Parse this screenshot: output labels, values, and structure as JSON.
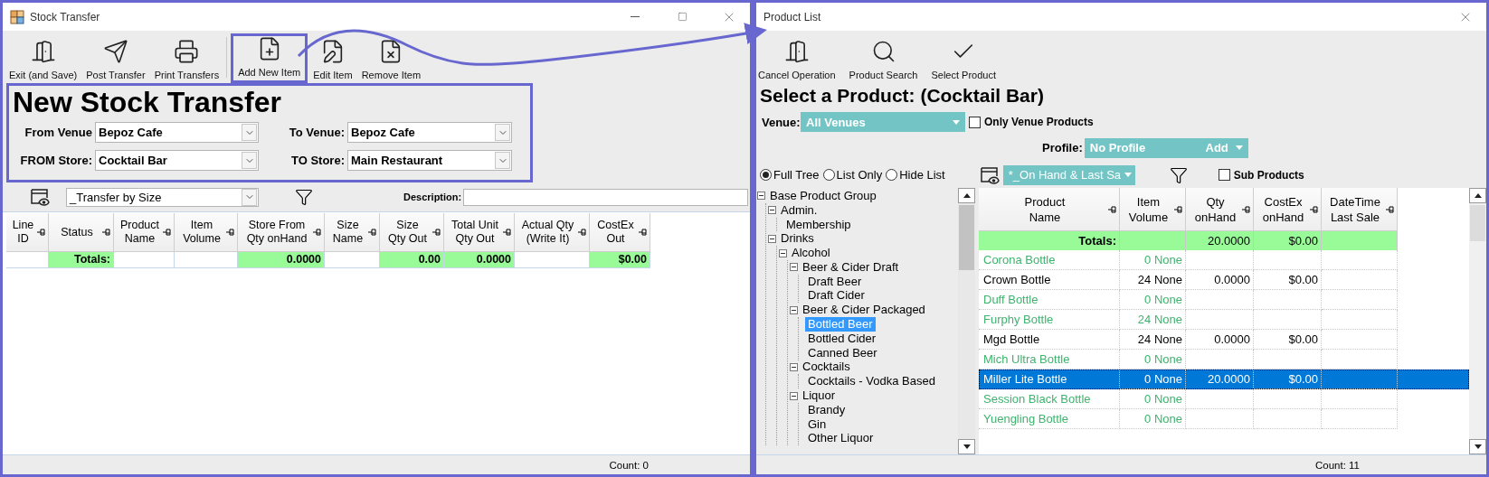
{
  "stock_transfer": {
    "title": "Stock Transfer",
    "toolbar": [
      {
        "label": "Exit (and Save)",
        "kind": "exit",
        "separator_before": false,
        "highlighted": false
      },
      {
        "label": "Post Transfer",
        "kind": "send",
        "separator_before": false,
        "highlighted": false
      },
      {
        "label": "Print Transfers",
        "kind": "print",
        "separator_before": false,
        "highlighted": false
      },
      {
        "label": "Add New Item",
        "kind": "add",
        "separator_before": true,
        "highlighted": true
      },
      {
        "label": "Edit Item",
        "kind": "edit",
        "separator_before": false,
        "highlighted": false
      },
      {
        "label": "Remove Item",
        "kind": "remove",
        "separator_before": false,
        "highlighted": false
      }
    ],
    "form_highlighted": true,
    "heading": "New Stock Transfer",
    "fields": [
      {
        "label": "From Venue",
        "value": "Bepoz Cafe"
      },
      {
        "label": "To Venue:",
        "value": "Bepoz Cafe"
      },
      {
        "label": "FROM Store:",
        "value": "Cocktail Bar"
      },
      {
        "label": "TO Store:",
        "value": "Main Restaurant"
      }
    ],
    "layout": "_Transfer by Size",
    "description_label": "Description:",
    "columns": [
      "Line\nID",
      "Status",
      "Product\nName",
      "Item\nVolume",
      "Store From\nQty onHand",
      "Size\nName",
      "Size\nQty Out",
      "Total Unit\nQty Out",
      "Actual Qty\n(Write It)",
      "CostEx\nOut"
    ],
    "totals": [
      {
        "highlighted": false
      },
      {
        "value": "Totals:",
        "highlighted": true
      },
      {
        "highlighted": false
      },
      {
        "highlighted": false
      },
      {
        "value": "0.0000",
        "highlighted": true
      },
      {
        "highlighted": false
      },
      {
        "value": "0.00",
        "highlighted": true
      },
      {
        "value": "0.0000",
        "highlighted": true
      },
      {
        "highlighted": false
      },
      {
        "value": "$0.00",
        "highlighted": true
      }
    ],
    "count": "Count: 0"
  },
  "product_list": {
    "title": "Product List",
    "toolbar": [
      {
        "label": "Cancel Operation",
        "kind": "exit"
      },
      {
        "label": "Product Search",
        "kind": "search"
      },
      {
        "label": "Select Product",
        "kind": "check"
      }
    ],
    "heading": "Select a Product: (Cocktail Bar)",
    "venue_label": "Venue:",
    "venue": "All Venues",
    "only_venue_products": {
      "label": "Only Venue Products",
      "checked": false
    },
    "profile_label": "Profile:",
    "profile": "No Profile",
    "profile_add": "Add",
    "view_options": [
      {
        "label": "Full Tree",
        "selected": true
      },
      {
        "label": "List Only",
        "selected": false
      },
      {
        "label": "Hide List",
        "selected": false
      }
    ],
    "layout": "*_On Hand & Last Sa",
    "sub_products": {
      "label": "Sub Products",
      "checked": false
    },
    "tree": [
      {
        "label": "Base Product Group",
        "expanded": true,
        "selected": false,
        "children": [
          {
            "label": "Admin.",
            "expanded": true,
            "selected": false,
            "children": [
              {
                "label": "Membership",
                "selected": false
              }
            ]
          },
          {
            "label": "Drinks",
            "expanded": true,
            "selected": false,
            "children": [
              {
                "label": "Alcohol",
                "expanded": true,
                "selected": false,
                "children": [
                  {
                    "label": "Beer & Cider Draft",
                    "expanded": true,
                    "selected": false,
                    "children": [
                      {
                        "label": "Draft Beer",
                        "selected": false
                      },
                      {
                        "label": "Draft Cider",
                        "selected": false
                      }
                    ]
                  },
                  {
                    "label": "Beer & Cider Packaged",
                    "expanded": true,
                    "selected": false,
                    "children": [
                      {
                        "label": "Bottled Beer",
                        "selected": true
                      },
                      {
                        "label": "Bottled Cider",
                        "selected": false
                      },
                      {
                        "label": "Canned Beer",
                        "selected": false
                      }
                    ]
                  },
                  {
                    "label": "Cocktails",
                    "expanded": true,
                    "selected": false,
                    "children": [
                      {
                        "label": "Cocktails - Vodka Based",
                        "selected": false
                      }
                    ]
                  },
                  {
                    "label": "Liquor",
                    "expanded": true,
                    "selected": false,
                    "children": [
                      {
                        "label": "Brandy",
                        "selected": false
                      },
                      {
                        "label": "Gin",
                        "selected": false
                      },
                      {
                        "label": "Other Liquor",
                        "selected": false
                      }
                    ]
                  }
                ]
              }
            ]
          }
        ]
      }
    ],
    "columns": [
      "Product\nName",
      "Item\nVolume",
      "Qty\nonHand",
      "CostEx\nonHand",
      "DateTime\nLast Sale"
    ],
    "totals": [
      {
        "value": "Totals:",
        "highlighted": true
      },
      {
        "highlighted": true
      },
      {
        "value": "20.0000",
        "highlighted": true
      },
      {
        "value": "$0.00",
        "highlighted": true
      },
      {
        "highlighted": true
      }
    ],
    "rows": [
      {
        "name": "Corona Bottle",
        "volume": "0 None",
        "in_stock": false,
        "selected": false
      },
      {
        "name": "Crown Bottle",
        "volume": "24 None",
        "qty": "0.0000",
        "cost": "$0.00",
        "in_stock": true,
        "selected": false
      },
      {
        "name": "Duff Bottle",
        "volume": "0 None",
        "in_stock": false,
        "selected": false
      },
      {
        "name": "Furphy Bottle",
        "volume": "24 None",
        "in_stock": false,
        "selected": false
      },
      {
        "name": "Mgd Bottle",
        "volume": "24 None",
        "qty": "0.0000",
        "cost": "$0.00",
        "in_stock": true,
        "selected": false
      },
      {
        "name": "Mich Ultra Bottle",
        "volume": "0 None",
        "in_stock": false,
        "selected": false
      },
      {
        "name": "Miller Lite Bottle",
        "volume": "0 None",
        "qty": "20.0000",
        "cost": "$0.00",
        "in_stock": true,
        "selected": true
      },
      {
        "name": "Session Black Bottle",
        "volume": "0 None",
        "in_stock": false,
        "selected": false
      },
      {
        "name": "Yuengling Bottle",
        "volume": "0 None",
        "in_stock": false,
        "selected": false
      }
    ],
    "count": "Count: 11"
  }
}
